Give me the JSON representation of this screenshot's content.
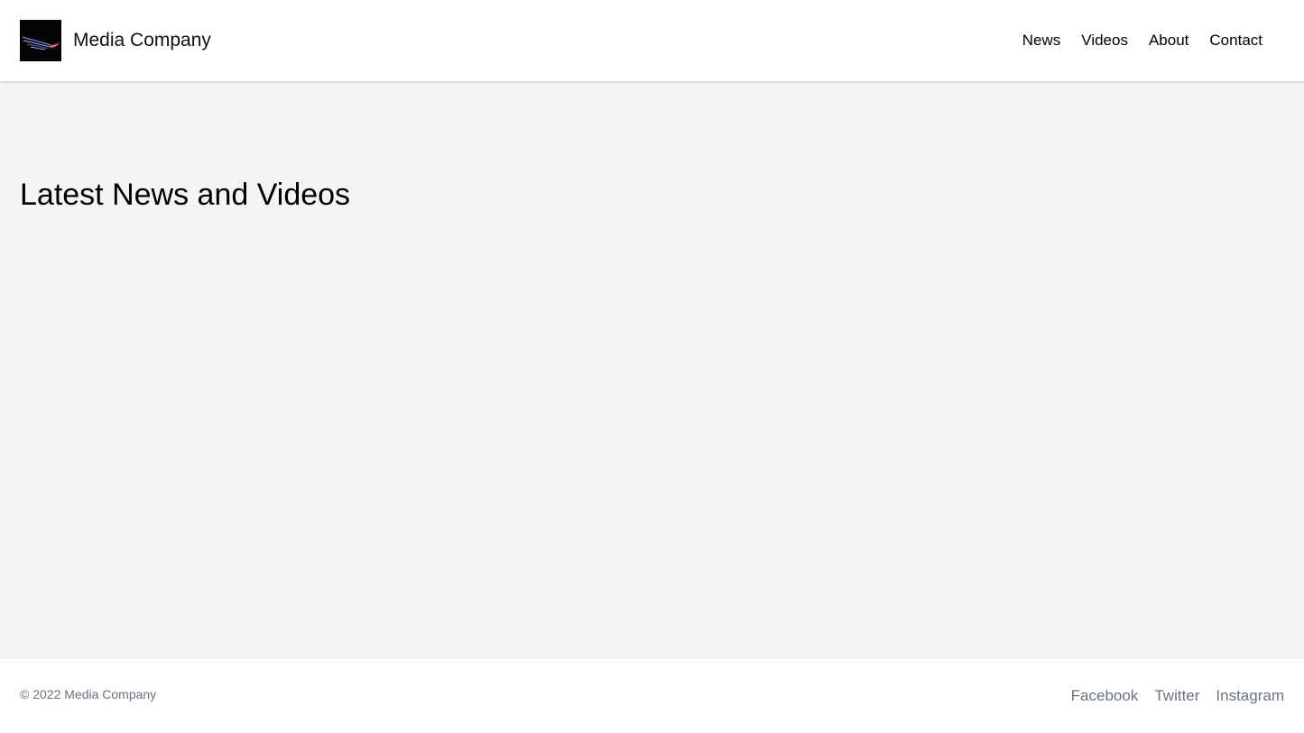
{
  "header": {
    "logo_icon": "media-company-logo",
    "brand_name": "Media Company",
    "nav": [
      {
        "label": "News"
      },
      {
        "label": "Videos"
      },
      {
        "label": "About"
      },
      {
        "label": "Contact"
      }
    ]
  },
  "main": {
    "title": "Latest News and Videos"
  },
  "footer": {
    "copyright": "© 2022 Media Company",
    "social": [
      {
        "label": "Facebook"
      },
      {
        "label": "Twitter"
      },
      {
        "label": "Instagram"
      }
    ]
  },
  "colors": {
    "page_background": "#f3f4f6",
    "header_background": "#ffffff",
    "footer_background": "#ffffff",
    "footer_text": "#6b7280"
  }
}
